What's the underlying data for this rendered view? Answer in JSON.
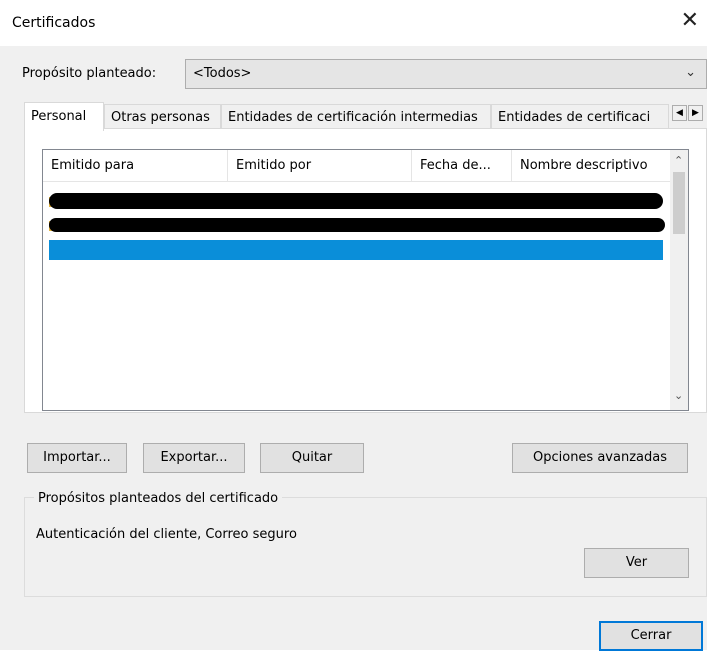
{
  "window": {
    "title": "Certificados",
    "close_glyph": "✕"
  },
  "purpose": {
    "label": "Propósito planteado:",
    "selected": "<Todos>",
    "chevron_glyph": "⌄"
  },
  "tabs": [
    {
      "label": "Personal",
      "active": true
    },
    {
      "label": "Otras personas"
    },
    {
      "label": "Entidades de certificación intermedias"
    },
    {
      "label": "Entidades de certificaci"
    }
  ],
  "tab_scroll": {
    "left_glyph": "◀",
    "right_glyph": "▶"
  },
  "list": {
    "columns": [
      "Emitido para",
      "Emitido por",
      "Fecha de...",
      "Nombre descriptivo"
    ],
    "rows": [
      {
        "redaction": "black",
        "icon": "certificate-icon"
      },
      {
        "redaction": "black",
        "icon": "certificate-icon"
      },
      {
        "redaction": "blue",
        "icon": "certificate-icon",
        "selected": true
      }
    ],
    "scroll_up_glyph": "⌃",
    "scroll_down_glyph": "⌄"
  },
  "buttons": {
    "import": "Importar...",
    "export": "Exportar...",
    "remove": "Quitar",
    "advanced": "Opciones avanzadas",
    "view": "Ver",
    "close": "Cerrar"
  },
  "purposes_group": {
    "title": "Propósitos planteados del certificado",
    "text": "Autenticación del cliente, Correo seguro"
  },
  "colors": {
    "dialog_bg": "#f0f0f0",
    "selection_blue": "#0a8ed9",
    "default_button_border": "#0078d7"
  }
}
